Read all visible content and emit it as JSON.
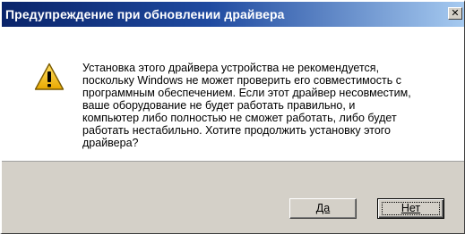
{
  "window": {
    "title": "Предупреждение при обновлении драйвера",
    "close_glyph": "✕"
  },
  "icon": "warning-icon",
  "message_lines": [
    "Установка этого драйвера устройства не рекомендуется,",
    "поскольку Windows не может проверить его совместимость с",
    "программным обеспечением.  Если этот драйвер несовместим,",
    "ваше оборудование не будет работать правильно, и",
    "компьютер либо полностью не сможет работать, либо будет",
    "работать нестабильно.  Хотите продолжить установку этого",
    "драйвера?"
  ],
  "buttons": {
    "yes_label": "Да",
    "no_label": "Нет"
  },
  "colors": {
    "title_start": "#0a246a",
    "title_end": "#a6caf0",
    "face": "#d4d0c8",
    "warning_fill": "#f5c400"
  }
}
